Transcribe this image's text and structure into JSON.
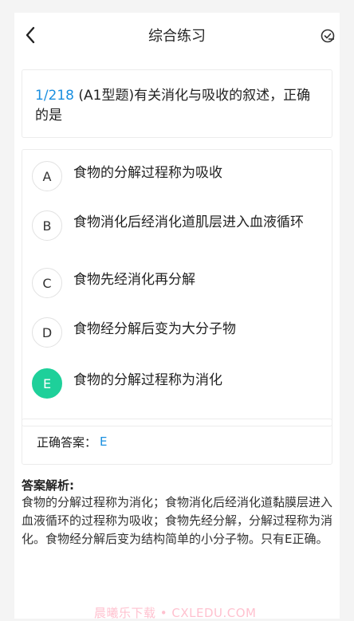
{
  "header": {
    "title": "综合练习",
    "back_icon": "chevron-left-icon",
    "check_icon": "check-list-icon"
  },
  "question": {
    "number": "1/218",
    "text": " (A1型题)有关消化与吸收的叙述，正确的是"
  },
  "options": [
    {
      "letter": "A",
      "text": "食物的分解过程称为吸收"
    },
    {
      "letter": "B",
      "text": "食物消化后经消化道肌层进入血液循环"
    },
    {
      "letter": "C",
      "text": "食物先经消化再分解"
    },
    {
      "letter": "D",
      "text": "食物经分解后变为大分子物"
    },
    {
      "letter": "E",
      "text": "食物的分解过程称为消化"
    }
  ],
  "answer": {
    "label": "正确答案：",
    "value": "E"
  },
  "analysis": {
    "heading": "答案解析:",
    "body": "食物的分解过程称为消化；食物消化后经消化道黏膜层进入血液循环的过程称为吸收；食物先经分解，分解过程称为消化。食物经分解后变为结构简单的小分子物。只有E正确。"
  },
  "watermark": "晨曦乐下载 • CXLEDU.COM",
  "colors": {
    "accent": "#1a8fe0",
    "correct": "#1ed09a"
  }
}
